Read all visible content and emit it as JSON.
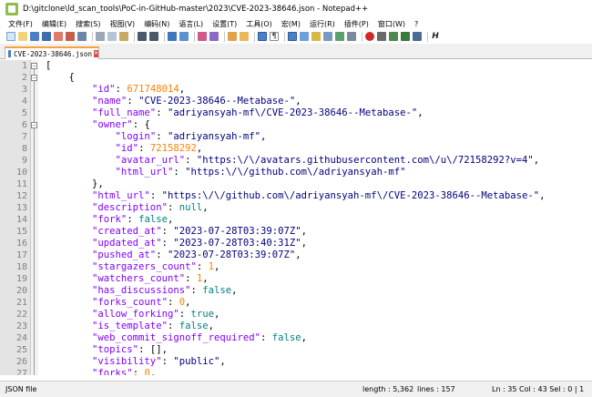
{
  "window": {
    "title": "D:\\gitclone\\ld_scan_tools\\PoC-in-GitHub-master\\2023\\CVE-2023-38646.json - Notepad++"
  },
  "menu": [
    "文件(F)",
    "编辑(E)",
    "搜索(S)",
    "视图(V)",
    "编码(N)",
    "语言(L)",
    "设置(T)",
    "工具(O)",
    "宏(M)",
    "运行(R)",
    "插件(P)",
    "窗口(W)",
    "?"
  ],
  "tab": {
    "label": "CVE-2023-38646.json",
    "close": "✕"
  },
  "lines": [
    {
      "n": "1",
      "html": "<span class='punc'>[</span>"
    },
    {
      "n": "2",
      "html": "    <span class='punc'>{</span>"
    },
    {
      "n": "3",
      "html": "        <span class='key'>\"id\"</span>: <span class='num'>671748014</span>,"
    },
    {
      "n": "4",
      "html": "        <span class='key'>\"name\"</span>: <span class='str'>\"CVE-2023-38646--Metabase-\"</span>,"
    },
    {
      "n": "5",
      "html": "        <span class='key'>\"full_name\"</span>: <span class='str'>\"adriyansyah-mf\\/CVE-2023-38646--Metabase-\"</span>,"
    },
    {
      "n": "6",
      "html": "        <span class='key'>\"owner\"</span>: {"
    },
    {
      "n": "7",
      "html": "            <span class='key'>\"login\"</span>: <span class='str'>\"adriyansyah-mf\"</span>,"
    },
    {
      "n": "8",
      "html": "            <span class='key'>\"id\"</span>: <span class='num'>72158292</span>,"
    },
    {
      "n": "9",
      "html": "            <span class='key'>\"avatar_url\"</span>: <span class='str'>\"https:\\/\\/avatars.githubusercontent.com\\/u\\/72158292?v=4\"</span>,"
    },
    {
      "n": "10",
      "html": "            <span class='key'>\"html_url\"</span>: <span class='str'>\"https:\\/\\/github.com\\/adriyansyah-mf\"</span>"
    },
    {
      "n": "11",
      "html": "        },"
    },
    {
      "n": "12",
      "html": "        <span class='key'>\"html_url\"</span>: <span class='str'>\"https:\\/\\/github.com\\/adriyansyah-mf\\/CVE-2023-38646--Metabase-\"</span>,"
    },
    {
      "n": "13",
      "html": "        <span class='key'>\"description\"</span>: <span class='bool'>null</span>,"
    },
    {
      "n": "14",
      "html": "        <span class='key'>\"fork\"</span>: <span class='bool'>false</span>,"
    },
    {
      "n": "15",
      "html": "        <span class='key'>\"created_at\"</span>: <span class='str'>\"2023-07-28T03:39:07Z\"</span>,"
    },
    {
      "n": "16",
      "html": "        <span class='key'>\"updated_at\"</span>: <span class='str'>\"2023-07-28T03:40:31Z\"</span>,"
    },
    {
      "n": "17",
      "html": "        <span class='key'>\"pushed_at\"</span>: <span class='str'>\"2023-07-28T03:39:07Z\"</span>,"
    },
    {
      "n": "18",
      "html": "        <span class='key'>\"stargazers_count\"</span>: <span class='num'>1</span>,"
    },
    {
      "n": "19",
      "html": "        <span class='key'>\"watchers_count\"</span>: <span class='num'>1</span>,"
    },
    {
      "n": "20",
      "html": "        <span class='key'>\"has_discussions\"</span>: <span class='bool'>false</span>,"
    },
    {
      "n": "21",
      "html": "        <span class='key'>\"forks_count\"</span>: <span class='num'>0</span>,"
    },
    {
      "n": "22",
      "html": "        <span class='key'>\"allow_forking\"</span>: <span class='bool'>true</span>,"
    },
    {
      "n": "23",
      "html": "        <span class='key'>\"is_template\"</span>: <span class='bool'>false</span>,"
    },
    {
      "n": "24",
      "html": "        <span class='key'>\"web_commit_signoff_required\"</span>: <span class='bool'>false</span>,"
    },
    {
      "n": "25",
      "html": "        <span class='key'>\"topics\"</span>: [],"
    },
    {
      "n": "26",
      "html": "        <span class='key'>\"visibility\"</span>: <span class='str'>\"public\"</span>,"
    },
    {
      "n": "27",
      "html": "        <span class='key'>\"forks\"</span>: <span class='num'>0</span>,"
    }
  ],
  "status": {
    "file_type": "JSON file",
    "length": "length : 5,362",
    "lines": "lines : 157",
    "position": "Ln : 35   Col : 43   Sel : 0 | 1"
  }
}
